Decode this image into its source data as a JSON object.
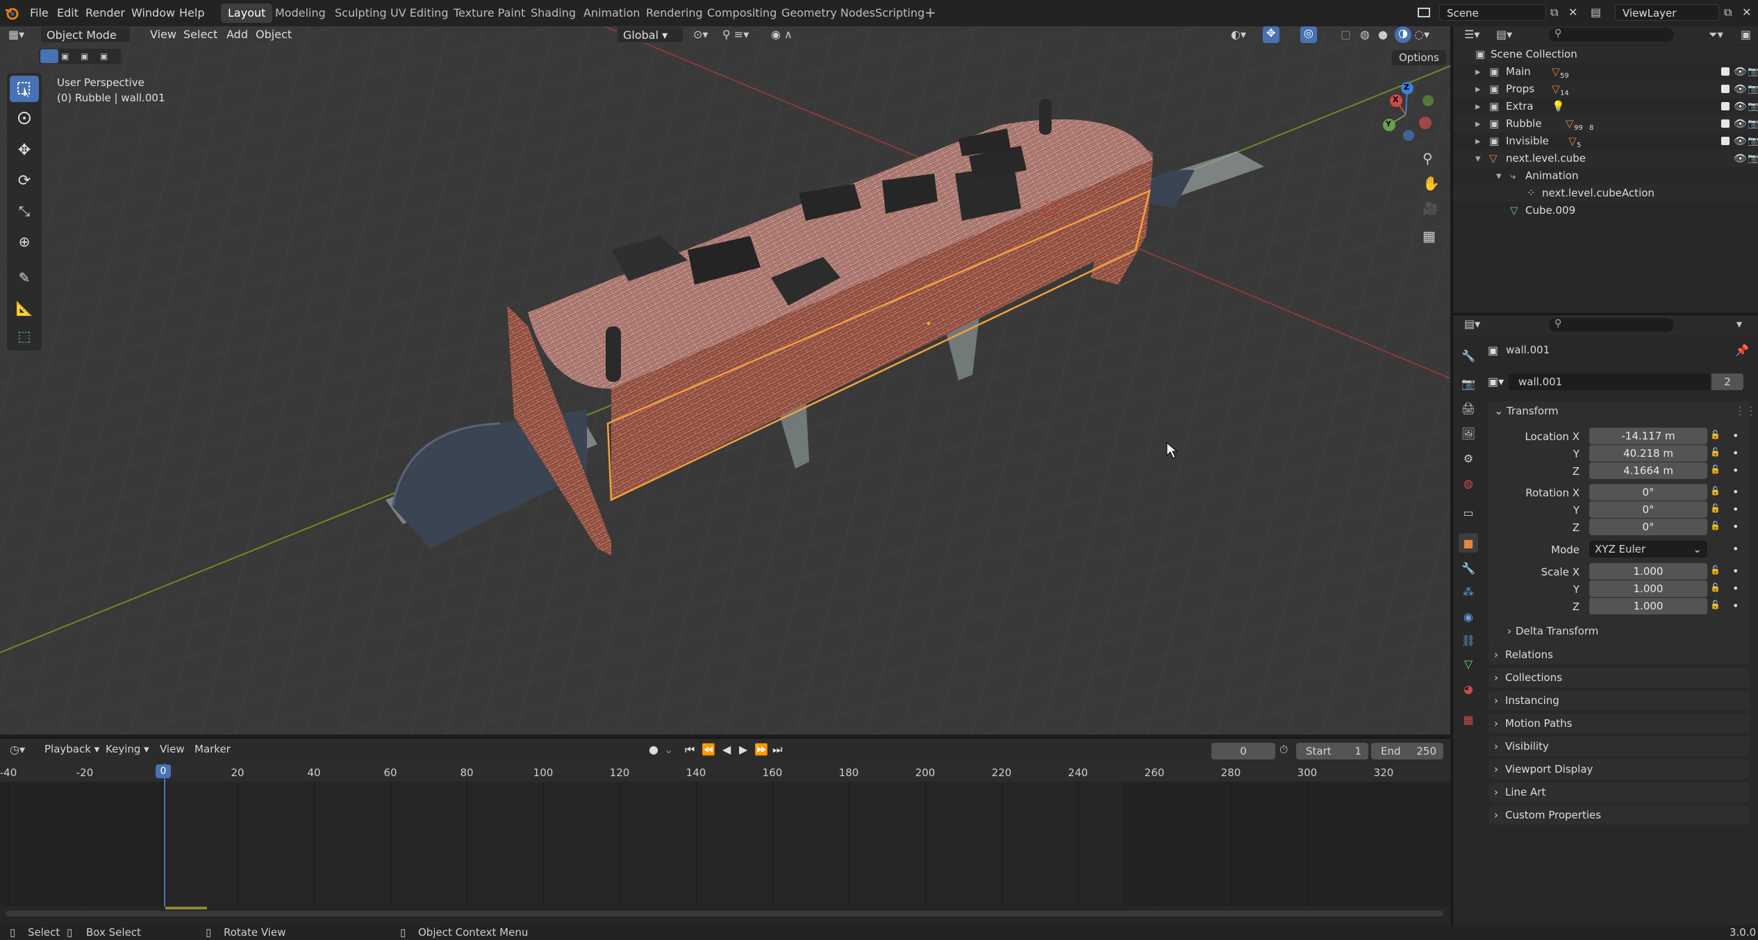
{
  "topbar": {
    "menus": [
      "File",
      "Edit",
      "Render",
      "Window",
      "Help"
    ],
    "workspaces": [
      "Layout",
      "Modeling",
      "Sculpting",
      "UV Editing",
      "Texture Paint",
      "Shading",
      "Animation",
      "Rendering",
      "Compositing",
      "Geometry Nodes",
      "Scripting"
    ],
    "active_workspace": "Layout",
    "scene_name": "Scene",
    "view_layer_name": "ViewLayer"
  },
  "viewport": {
    "mode": "Object Mode",
    "menus": [
      "View",
      "Select",
      "Add",
      "Object"
    ],
    "transform_orientation": "Global",
    "options_label": "Options",
    "overlay_title": "User Perspective",
    "overlay_subtitle": "(0) Rubble | wall.001",
    "gizmo_axes": [
      "X",
      "Y",
      "Z"
    ]
  },
  "tools": [
    "select-box",
    "cursor",
    "move",
    "rotate",
    "scale",
    "transform",
    "annotate",
    "measure",
    "add-cube"
  ],
  "outliner": {
    "root": "Scene Collection",
    "rows": [
      {
        "label": "Main",
        "badge": "59",
        "indent": 1
      },
      {
        "label": "Props",
        "badge": "14",
        "indent": 1
      },
      {
        "label": "Extra",
        "badge": "",
        "indent": 1
      },
      {
        "label": "Rubble",
        "badge": "99",
        "badge2": "8",
        "indent": 1
      },
      {
        "label": "Invisible",
        "badge": "5",
        "indent": 1
      },
      {
        "label": "next.level.cube",
        "badge": "",
        "indent": 1
      },
      {
        "label": "Animation",
        "badge": "",
        "indent": 2
      },
      {
        "label": "next.level.cubeAction",
        "badge": "",
        "indent": 3
      },
      {
        "label": "Cube.009",
        "badge": "",
        "indent": 2
      }
    ]
  },
  "properties": {
    "object_name": "wall.001",
    "datablock_name": "wall.001",
    "datablock_users": "2",
    "transform_label": "Transform",
    "location_label": "Location X",
    "location": [
      "-14.117 m",
      "40.218 m",
      "4.1664 m"
    ],
    "rotation_label": "Rotation X",
    "rotation": [
      "0°",
      "0°",
      "0°"
    ],
    "mode_label": "Mode",
    "mode_value": "XYZ Euler",
    "scale_label": "Scale X",
    "scale": [
      "1.000",
      "1.000",
      "1.000"
    ],
    "axis_y": "Y",
    "axis_z": "Z",
    "delta_transform": "Delta Transform",
    "panels": [
      "Relations",
      "Collections",
      "Instancing",
      "Motion Paths",
      "Visibility",
      "Viewport Display",
      "Line Art",
      "Custom Properties"
    ]
  },
  "timeline": {
    "menus": [
      "Playback",
      "Keying",
      "View",
      "Marker"
    ],
    "current_frame": "0",
    "start_label": "Start",
    "start_value": "1",
    "end_label": "End",
    "end_value": "250",
    "ruler_ticks": [
      "-40",
      "-20",
      "0",
      "20",
      "40",
      "60",
      "80",
      "100",
      "120",
      "140",
      "160",
      "180",
      "200",
      "220",
      "240",
      "260",
      "280",
      "300",
      "320"
    ]
  },
  "statusbar": {
    "items": [
      "Select",
      "Box Select",
      "Rotate View",
      "Object Context Menu"
    ],
    "version": "3.0.0"
  },
  "colors": {
    "accent": "#4772b3",
    "selection": "#f5a13b",
    "brick": "#8a4a3c"
  }
}
